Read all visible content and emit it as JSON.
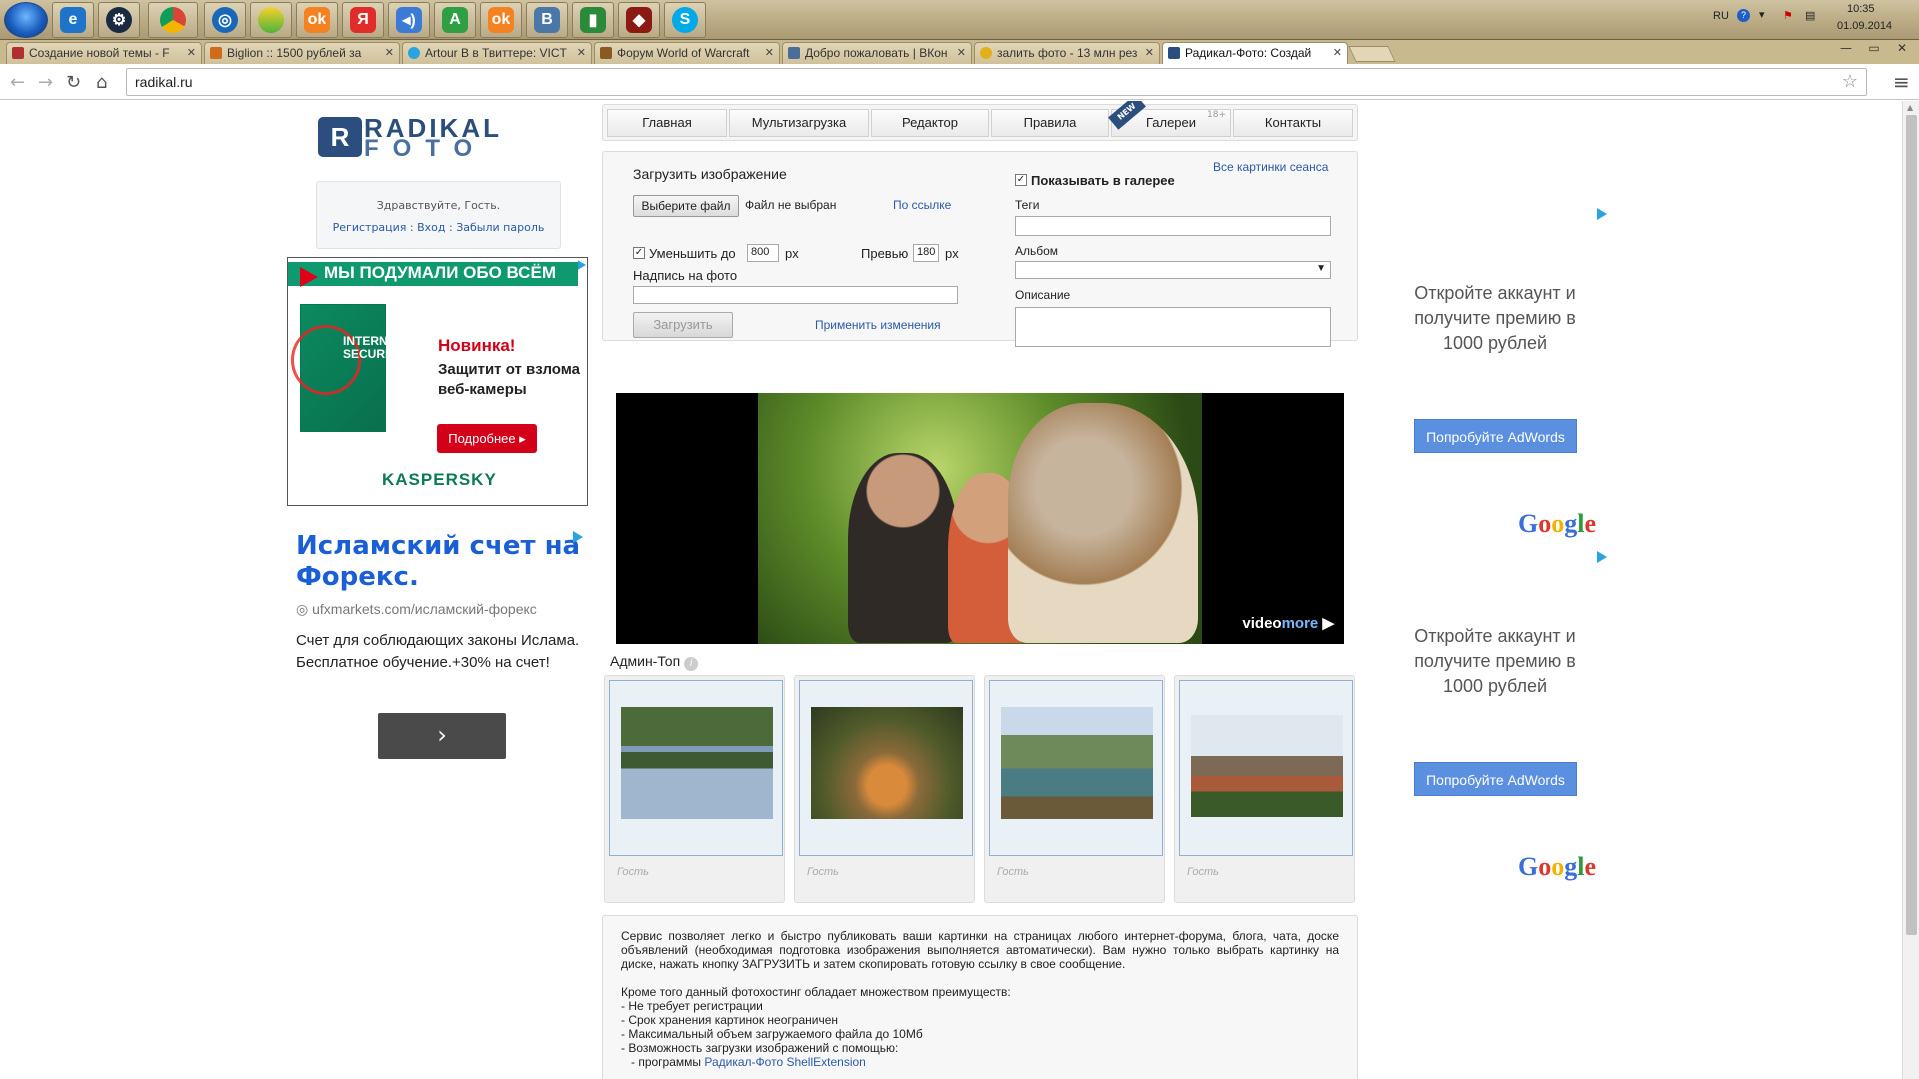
{
  "taskbar": {
    "icons": [
      "windows-start",
      "internet-explorer",
      "steam",
      "chrome",
      "opera-browser",
      "app-lime",
      "odnoklassniki",
      "yandex",
      "media-player",
      "app-green-a",
      "odnoklassniki-2",
      "vkontakte",
      "stats",
      "dota",
      "skype"
    ],
    "tray": {
      "lang": "RU",
      "time": "10:35",
      "date": "01.09.2014"
    }
  },
  "browser": {
    "tabs": [
      {
        "title": "Создание новой темы - F",
        "color": "#b03030"
      },
      {
        "title": "Biglion :: 1500 рублей за",
        "color": "#d26a1c"
      },
      {
        "title": "Artour B в Твиттере: VICT",
        "color": "#2aa4e0"
      },
      {
        "title": "Форум World of Warcraft",
        "color": "#8a5a22"
      },
      {
        "title": "Добро пожаловать | ВКон",
        "color": "#4a6d9a"
      },
      {
        "title": "залить фото - 13 млн рез",
        "color": "#e4b019"
      },
      {
        "title": "Радикал-Фото: Создай",
        "color": "#2c4e7e"
      }
    ],
    "url": "radikal.ru",
    "window_controls": [
      "—",
      "▭",
      "✕"
    ]
  },
  "site": {
    "logo": {
      "letter": "R",
      "line1": "RADIKAL",
      "line2": "FOTO"
    },
    "greeting": "Здравствуйте, Гость.",
    "auth_links": [
      "Регистрация",
      "Вход",
      "Забыли пароль"
    ],
    "menu": [
      {
        "label": "Главная"
      },
      {
        "label": "Мультизагрузка"
      },
      {
        "label": "Редактор"
      },
      {
        "label": "Правила"
      },
      {
        "label": "Галереи"
      },
      {
        "label": "Контакты"
      }
    ],
    "new_tag": "NEW",
    "age_tag": "18+"
  },
  "upload": {
    "heading": "Загрузить изображение",
    "choose_file": "Выберите файл",
    "no_file": "Файл не выбран",
    "by_link": "По ссылке",
    "shrink_label": "Уменьшить до",
    "shrink_value": "800",
    "px1": "px",
    "preview_label": "Превью",
    "preview_value": "180",
    "px2": "px",
    "caption_label": "Надпись на фото",
    "upload_button": "Загрузить",
    "apply_changes": "Применить изменения",
    "show_in_gallery": "Показывать в галерее",
    "session_pics": "Все картинки сеанса",
    "tags_label": "Теги",
    "album_label": "Альбом",
    "desc_label": "Описание"
  },
  "video": {
    "brand": "video",
    "brand2": "more"
  },
  "admin_top": {
    "title": "Админ-Топ",
    "info": "i",
    "items": [
      {
        "author": "Гость",
        "theme": "lake"
      },
      {
        "author": "Гость",
        "theme": "cat"
      },
      {
        "author": "Гость",
        "theme": "mountain-lake"
      },
      {
        "author": "Гость",
        "theme": "city"
      }
    ]
  },
  "description": {
    "p1": "Сервис позволяет легко и быстро публиковать ваши картинки на страницах любого интернет-форума, блога, чата, доске объявлений (необходимая подготовка изображения выполняется автоматически). Вам нужно только выбрать картинку на диске, нажать кнопку ЗАГРУЗИТЬ и затем скопировать готовую ссылку в свое сообщение.",
    "p2_intro": "Кроме того данный фотохостинг обладает множеством преимуществ:",
    "list": [
      "- Не требует регистрации",
      "- Срок хранения картинок неограничен",
      "- Максимальный объем загружаемого файла до 10Мб",
      "- Возможность загрузки изображений с помощью:"
    ],
    "sub_prefix": "- программы",
    "sub_link": "Радикал-Фото ShellExtension"
  },
  "ads": {
    "kaspersky": {
      "banner": "МЫ ПОДУМАЛИ ОБО ВСЁМ",
      "box_text": "INTERNET SECURITY",
      "new": "Новинка!",
      "desc": "Защитит от взлома веб-камеры",
      "button": "Подробнее ▸",
      "logo": "KASPERSKY"
    },
    "islam": {
      "headline": "Исламский счет на Форекс.",
      "url": "ufxmarkets.com/исламский-форекс",
      "body": "Счет для соблюдающих законы Ислама. Бесплатное обучение.+30% на счет!",
      "arrow": "›"
    },
    "adwords": [
      {
        "text": "Откройте аккаунт и получите премию в 1000 рублей",
        "button": "Попробуйте AdWords"
      },
      {
        "text": "Откройте аккаунт и получите премию в 1000 рублей",
        "button": "Попробуйте AdWords"
      }
    ],
    "google_letters": [
      "G",
      "o",
      "o",
      "g",
      "l",
      "e"
    ],
    "google_colors": [
      "#3b6fd8",
      "#d93a2b",
      "#f0b400",
      "#3b6fd8",
      "#2e9b3e",
      "#d93a2b"
    ]
  }
}
